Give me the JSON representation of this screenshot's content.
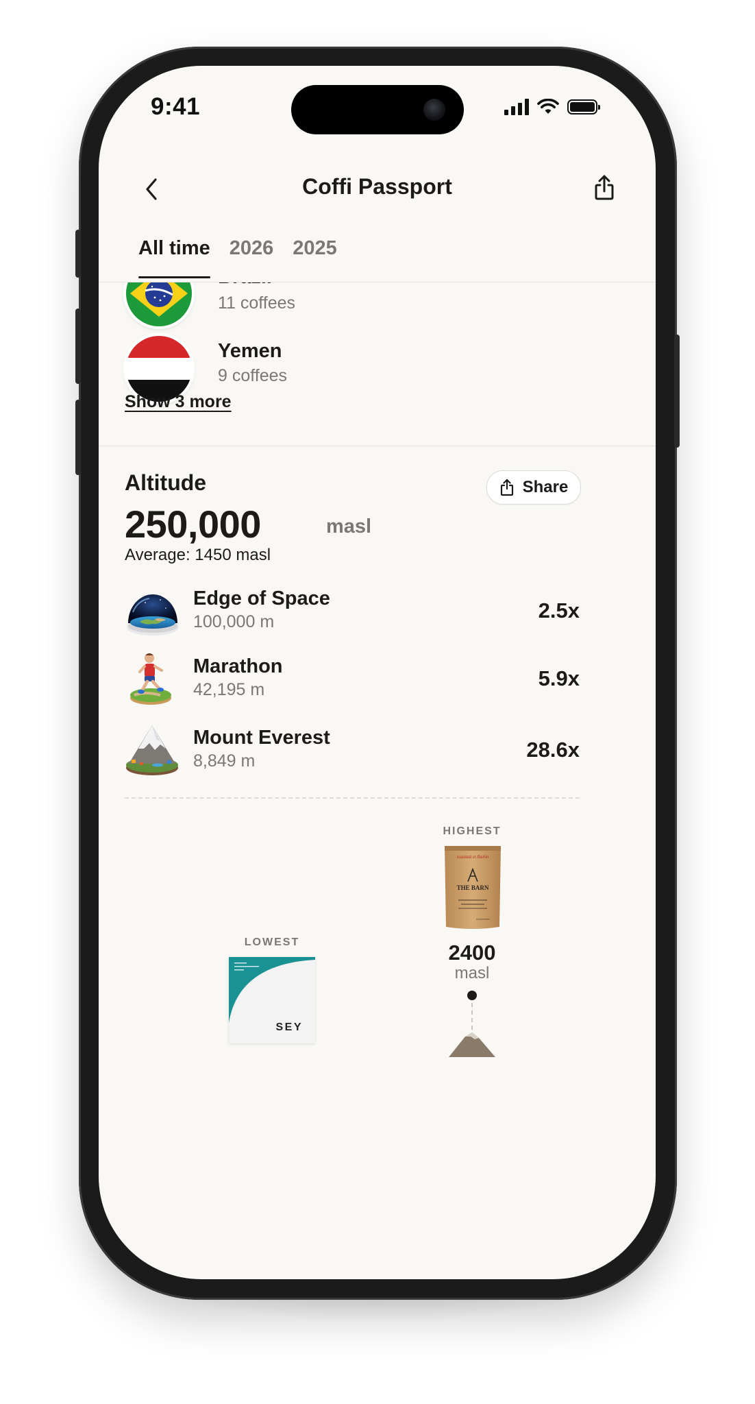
{
  "status_bar": {
    "time": "9:41"
  },
  "nav": {
    "title": "Coffi Passport",
    "back_icon": "chevron-left-icon",
    "export_icon": "share-icon"
  },
  "tabs": [
    {
      "label": "All time",
      "active": true
    },
    {
      "label": "2026",
      "active": false
    },
    {
      "label": "2025",
      "active": false
    }
  ],
  "countries": [
    {
      "name": "Brazil",
      "count": "11 coffees",
      "flag": "brazil-flag-icon"
    },
    {
      "name": "Yemen",
      "count": "9 coffees",
      "flag": "yemen-flag-icon"
    }
  ],
  "show_more": "Show 3 more",
  "altitude": {
    "label": "Altitude",
    "share_label": "Share",
    "total": "250,000",
    "unit": "masl",
    "average": "Average: 1450 masl",
    "comparisons": [
      {
        "title": "Edge of Space",
        "height": "100,000 m",
        "multiplier": "2.5x",
        "icon": "earth-dome-icon"
      },
      {
        "title": "Marathon",
        "height": "42,195 m",
        "multiplier": "5.9x",
        "icon": "runner-icon"
      },
      {
        "title": "Mount Everest",
        "height": "8,849 m",
        "multiplier": "28.6x",
        "icon": "mountain-icon"
      }
    ],
    "highest": {
      "caption": "HIGHEST",
      "value": "2400",
      "unit": "masl",
      "bag_brand": "THE BARN",
      "bag_top": "roasted in Berlin"
    },
    "lowest": {
      "caption": "LOWEST",
      "brand": "SEY"
    }
  },
  "colors": {
    "background": "#f9f8f5",
    "text": "#1c1b19",
    "muted": "#7b7873",
    "sey_teal": "#1a9294"
  }
}
